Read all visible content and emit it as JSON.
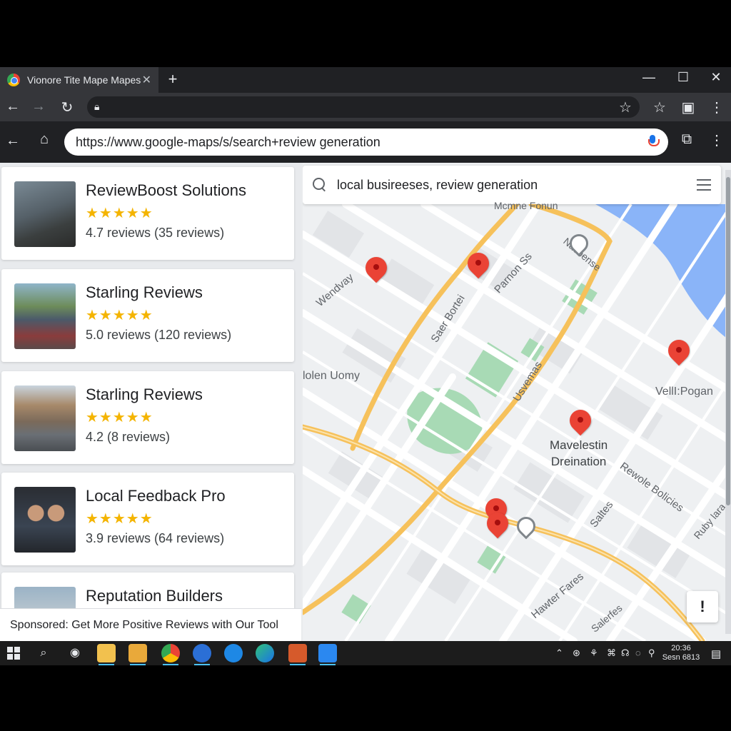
{
  "browser": {
    "tab_title": "Vionore Tite Mape Mapes",
    "tab_close": "✕",
    "new_tab": "+",
    "window_controls": [
      "—",
      "☐",
      "✕"
    ],
    "url": "https://www.google-maps/s/search+review generation"
  },
  "list": {
    "results": [
      {
        "name": "ReviewBoost Solutions",
        "stars": "★★★★★",
        "reviews": "4.7 reviews (35 reviews)"
      },
      {
        "name": "Starling Reviews",
        "stars": "★★★★★",
        "reviews": "5.0 reviews (120 reviews)"
      },
      {
        "name": "Starling Reviews",
        "stars": "★★★★★",
        "reviews": "4.2 (8 reviews)"
      },
      {
        "name": "Local Feedback Pro",
        "stars": "★★★★★",
        "reviews": "3.9 reviews (64 reviews)"
      },
      {
        "name": "Reputation Builders",
        "stars": "",
        "reviews": ""
      }
    ],
    "sponsored": "Sponsored: Get More Positive Reviews with Our Tool"
  },
  "map": {
    "search_query": "local busireeses, review generation",
    "labels": {
      "top": "Mcmne Fonun",
      "wendvay": "Wendvay",
      "sersr": "Saer Bortei",
      "parnon": "Parnon Ss",
      "nasbense": "Nacbense",
      "olen": "lolen Uomy",
      "usvemas": "Usvemas",
      "vell": "VellI:Pogan",
      "mavelestin": "Mavelestin",
      "dreination": "Dreination",
      "revolle": "Rewole Bolicies",
      "saltos": "Saltes",
      "hawter": "Hawter Fares",
      "ruby": "Ruby lara",
      "saler": "Salerfes"
    },
    "feedback_button": "!"
  },
  "taskbar": {
    "clock_time": "20:36",
    "clock_date": "Sesn 6813"
  },
  "colors": {
    "pin": "#ea4335",
    "star": "#f4b400",
    "water": "#8ab4f8",
    "park": "#a8dab5",
    "road": "#f6c15b"
  }
}
